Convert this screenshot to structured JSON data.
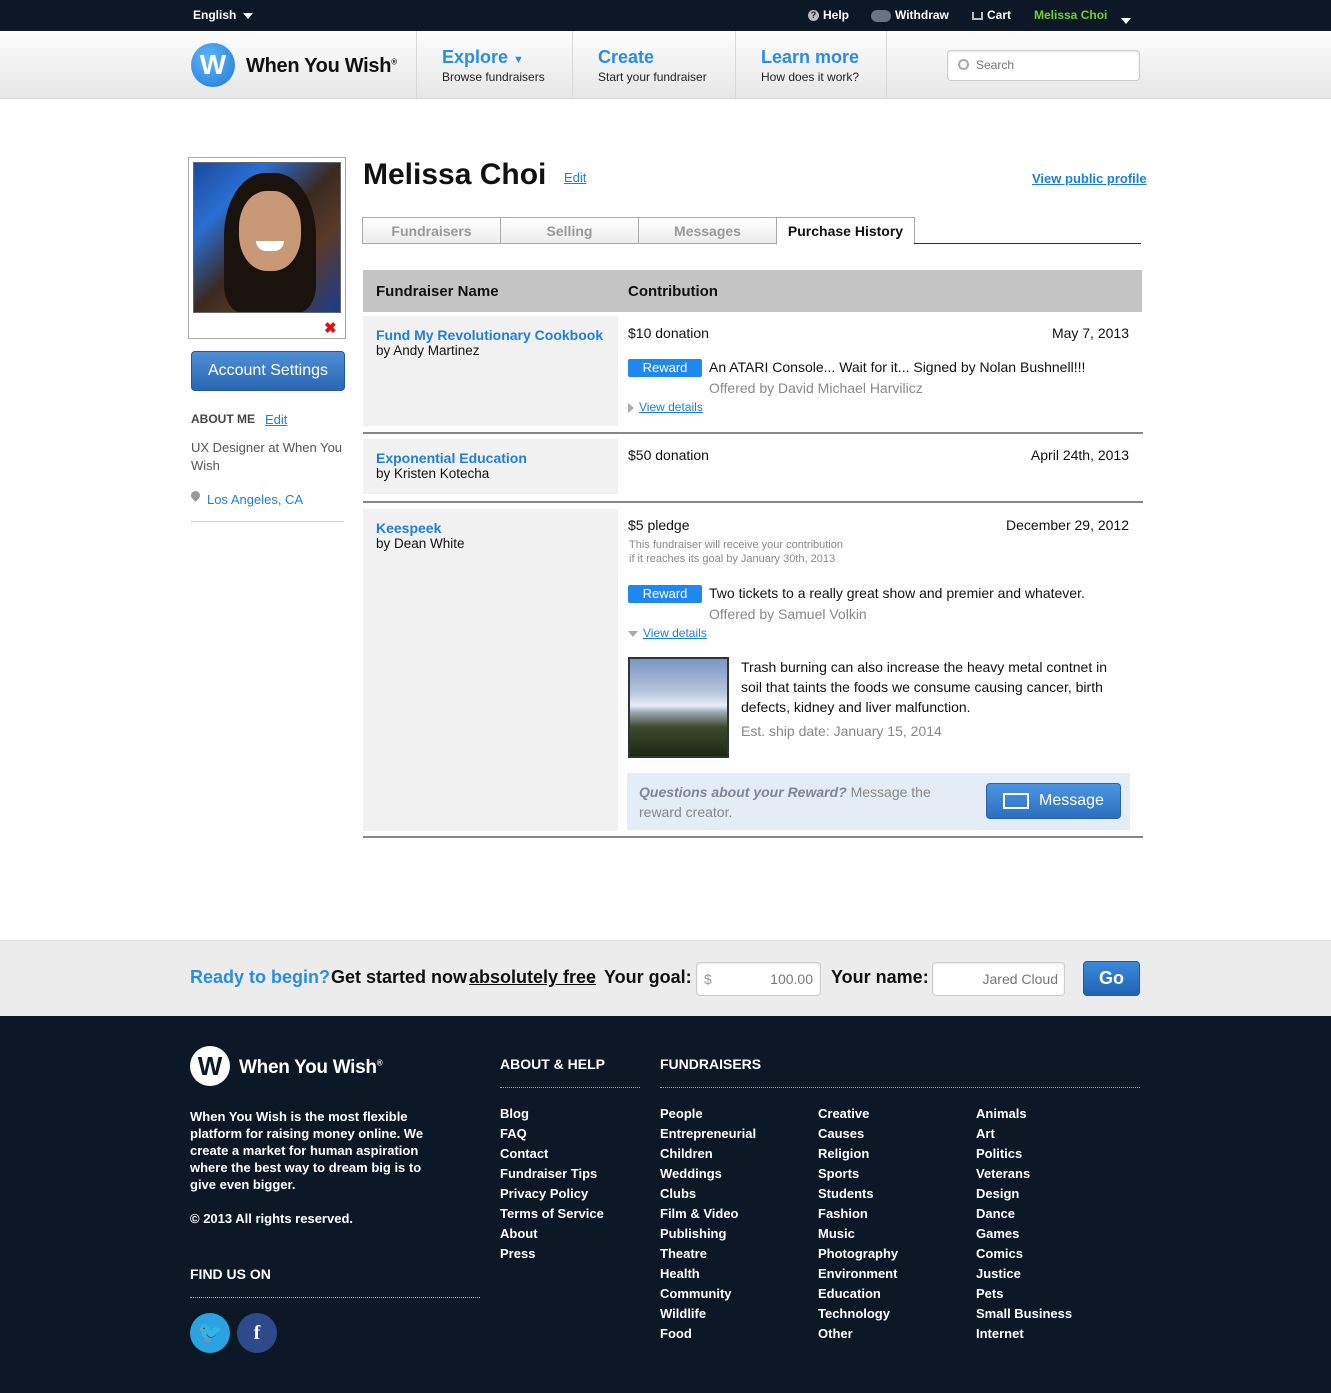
{
  "topbar": {
    "language": "English",
    "help": "Help",
    "withdraw": "Withdraw",
    "cart": "Cart",
    "username": "Melissa Choi"
  },
  "header": {
    "logo_letter": "W",
    "logo_text": "When You Wish",
    "logo_mark": "®",
    "nav": [
      {
        "title": "Explore",
        "subtitle": "Browse fundraisers"
      },
      {
        "title": "Create",
        "subtitle": "Start your fundraiser"
      },
      {
        "title": "Learn more",
        "subtitle": "How does it work?"
      }
    ],
    "search_placeholder": "Search"
  },
  "sidebar": {
    "account_settings": "Account Settings",
    "about_heading": "ABOUT ME",
    "about_edit": "Edit",
    "about_text": "UX Designer at When You Wish",
    "location": "Los Angeles, CA"
  },
  "profile": {
    "name": "Melissa Choi",
    "edit": "Edit",
    "view_public": "View public profile",
    "tabs": [
      "Fundraisers",
      "Selling",
      "Messages",
      "Purchase History"
    ],
    "active_tab": "Purchase History"
  },
  "table": {
    "col_name": "Fundraiser Name",
    "col_contribution": "Contribution",
    "rows": [
      {
        "fundraiser": "Fund My Revolutionary Cookbook",
        "by": "by Andy Martinez",
        "amount": "$10 donation",
        "date": "May 7, 2013",
        "reward_badge": "Reward",
        "reward_title": "An ATARI Console... Wait for it... Signed by Nolan Bushnell!!!",
        "offered_by": "Offered by David Michael Harvilicz",
        "view_details": "View details"
      },
      {
        "fundraiser": "Exponential Education",
        "by": "by Kristen Kotecha",
        "amount": "$50 donation",
        "date": "April 24th, 2013"
      },
      {
        "fundraiser": "Keespeek",
        "by": "by Dean White",
        "amount": "$5 pledge",
        "date": "December 29, 2012",
        "note_line1": "This fundraiser will receive your contribution",
        "note_line2": "if it reaches its goal by January 30th, 2013",
        "reward_badge": "Reward",
        "reward_title": "Two tickets to a really great show and premier and whatever.",
        "offered_by": "Offered by Samuel Volkin",
        "view_details": "View details",
        "description": "Trash burning can also increase the heavy metal contnet in soil that taints the foods we consume causing cancer, birth defects, kidney and liver malfunction.",
        "ship_date": "Est. ship date: January 15, 2014",
        "question_bold": "Questions about your Reward?",
        "question_rest": " Message the reward creator.",
        "message_button": "Message"
      }
    ]
  },
  "cta": {
    "ready": "Ready to begin?",
    "started": "Get started now",
    "free": "absolutely free",
    "period": ".",
    "goal_label": "Your goal:",
    "currency": "$",
    "goal_value": "100.00",
    "name_label": "Your name:",
    "name_value": "Jared Cloud",
    "go": "Go"
  },
  "footer": {
    "logo_text": "When You Wish",
    "logo_mark": "®",
    "blurb": "When You Wish is the most flexible platform for raising money online. We create a market for human aspiration where the best way to dream big is to give even bigger.",
    "copyright": "© 2013 All rights reserved.",
    "find_us": "FIND US ON",
    "about_heading": "ABOUT & HELP",
    "about_links": [
      "Blog",
      "FAQ",
      "Contact",
      "Fundraiser Tips",
      "Privacy Policy",
      "Terms of Service",
      "About",
      "Press"
    ],
    "fundraisers_heading": "FUNDRAISERS",
    "col1": [
      "People",
      "Entrepreneurial",
      "Children",
      "Weddings",
      "Clubs",
      "Film & Video",
      "Publishing",
      "Theatre",
      "Health",
      "Community",
      "Wildlife",
      "Food"
    ],
    "col2": [
      "Creative",
      "Causes",
      "Religion",
      "Sports",
      "Students",
      "Fashion",
      "Music",
      "Photography",
      "Environment",
      "Education",
      "Technology",
      "Other"
    ],
    "col3": [
      "Animals",
      "Art",
      "Politics",
      "Veterans",
      "Design",
      "Dance",
      "Games",
      "Comics",
      "Justice",
      "Pets",
      "Small Business",
      "Internet"
    ]
  },
  "colors": {
    "accent": "#1e7fd8",
    "dark": "#0d1826",
    "username_green": "#6fd12e"
  }
}
